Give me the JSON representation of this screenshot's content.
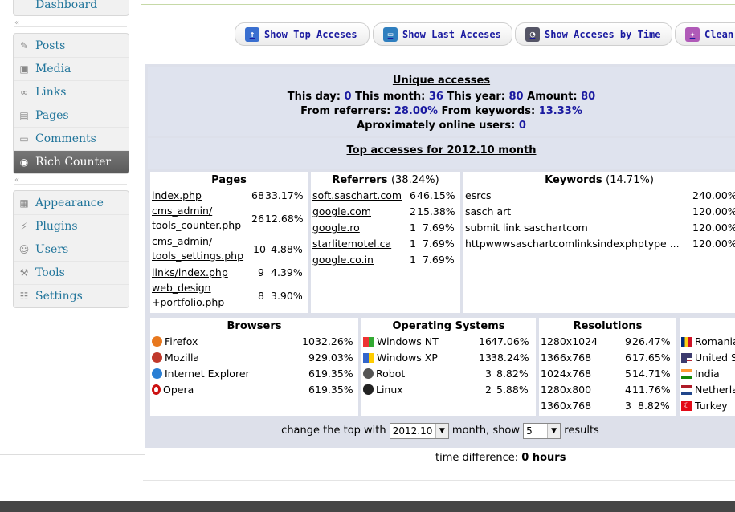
{
  "sidebar": {
    "top_item": "Dashboard",
    "group1": [
      "Posts",
      "Media",
      "Links",
      "Pages",
      "Comments",
      "Rich Counter"
    ],
    "group2": [
      "Appearance",
      "Plugins",
      "Users",
      "Tools",
      "Settings"
    ],
    "active": "Rich Counter"
  },
  "toolbar": {
    "top": "Show Top Acceses",
    "last": "Show Last Acceses",
    "time": "Show Acceses by Time",
    "clean": "Clean"
  },
  "unique": {
    "title": "Unique accesses",
    "day_label": "This day:",
    "day": "0",
    "month_label": "This month:",
    "month": "36",
    "year_label": "This year:",
    "year": "80",
    "amount_label": "Amount:",
    "amount": "80",
    "ref_label": "From referrers:",
    "ref": "28.00%",
    "kw_label": "From keywords:",
    "kw": "13.33%",
    "online_label": "Aproximately online users:",
    "online": "0"
  },
  "top_title": "Top accesses for 2012.10 month",
  "pages": {
    "title": "Pages",
    "rows": [
      {
        "a": "index.php",
        "b": "",
        "n": "68",
        "p": "33.17%"
      },
      {
        "a": "cms_admin/",
        "b": "tools_counter.php",
        "n": "26",
        "p": "12.68%"
      },
      {
        "a": "cms_admin/",
        "b": "tools_settings.php",
        "n": "10",
        "p": "4.88%"
      },
      {
        "a": "links/index.php",
        "b": "",
        "n": "9",
        "p": "4.39%"
      },
      {
        "a": "web_design",
        "b": "+portfolio.php",
        "n": "8",
        "p": "3.90%"
      }
    ]
  },
  "referrers": {
    "title": "Referrers",
    "pct": "(38.24%)",
    "rows": [
      {
        "a": "soft.saschart.com",
        "n": "6",
        "p": "46.15%"
      },
      {
        "a": "google.com",
        "n": "2",
        "p": "15.38%"
      },
      {
        "a": "google.ro",
        "n": "1",
        "p": "7.69%"
      },
      {
        "a": "starlitemotel.ca",
        "n": "1",
        "p": "7.69%"
      },
      {
        "a": "google.co.in",
        "n": "1",
        "p": "7.69%"
      }
    ]
  },
  "keywords": {
    "title": "Keywords",
    "pct": "(14.71%)",
    "rows": [
      {
        "a": "esrcs",
        "n": "2",
        "p": "40.00%"
      },
      {
        "a": "sasch art",
        "n": "1",
        "p": "20.00%"
      },
      {
        "a": "submit link saschartcom",
        "n": "1",
        "p": "20.00%"
      },
      {
        "a": "httpwwwsaschartcomlinksindexphptype ...",
        "n": "1",
        "p": "20.00%"
      }
    ]
  },
  "browsers": {
    "title": "Browsers",
    "rows": [
      {
        "a": "Firefox",
        "n": "10",
        "p": "32.26%",
        "icon": "firefox-icon",
        "color": "#e8781e"
      },
      {
        "a": "Mozilla",
        "n": "9",
        "p": "29.03%",
        "icon": "mozilla-icon",
        "color": "#c0392b"
      },
      {
        "a": "Internet Explorer",
        "n": "6",
        "p": "19.35%",
        "icon": "ie-icon",
        "color": "#2a7fd4"
      },
      {
        "a": "Opera",
        "n": "6",
        "p": "19.35%",
        "icon": "opera-icon",
        "color": "#cc1111"
      }
    ]
  },
  "os": {
    "title": "Operating Systems",
    "rows": [
      {
        "a": "Windows NT",
        "n": "16",
        "p": "47.06%",
        "icon": "windows-icon"
      },
      {
        "a": "Windows XP",
        "n": "13",
        "p": "38.24%",
        "icon": "windows-icon"
      },
      {
        "a": "Robot",
        "n": "3",
        "p": "8.82%",
        "icon": "robot-icon"
      },
      {
        "a": "Linux",
        "n": "2",
        "p": "5.88%",
        "icon": "linux-icon"
      }
    ]
  },
  "resolutions": {
    "title": "Resolutions",
    "rows": [
      {
        "a": "1280x1024",
        "n": "9",
        "p": "26.47%"
      },
      {
        "a": "1366x768",
        "n": "6",
        "p": "17.65%"
      },
      {
        "a": "1024x768",
        "n": "5",
        "p": "14.71%"
      },
      {
        "a": "1280x800",
        "n": "4",
        "p": "11.76%"
      },
      {
        "a": "1360x768",
        "n": "3",
        "p": "8.82%"
      }
    ]
  },
  "countries": {
    "rows": [
      {
        "a": "Romania",
        "flag": "romania-flag"
      },
      {
        "a": "United S",
        "flag": "usa-flag"
      },
      {
        "a": "India",
        "flag": "india-flag"
      },
      {
        "a": "Netherla",
        "flag": "netherlands-flag"
      },
      {
        "a": "Turkey",
        "flag": "turkey-flag"
      }
    ]
  },
  "controls": {
    "prefix": "change the top with",
    "month_value": "2012.10",
    "middle": "month, show",
    "count_value": "5",
    "suffix": "results"
  },
  "time_diff": {
    "label": "time difference:",
    "value": "0 hours"
  }
}
